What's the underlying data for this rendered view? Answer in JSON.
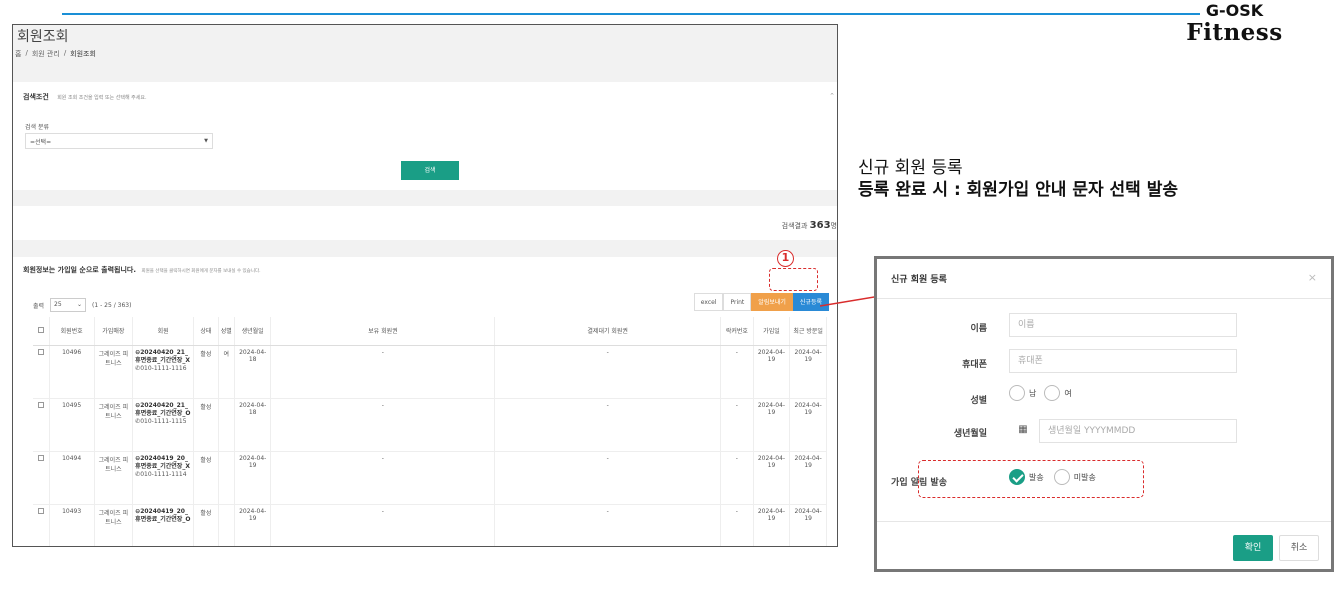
{
  "brand": {
    "line1": "G-OSK",
    "line2": "Fitness"
  },
  "app": {
    "title": "회원조회",
    "breadcrumb": [
      "홈",
      "/",
      "회원 관리",
      "/",
      "회원조회"
    ],
    "search": {
      "header": "검색조건",
      "hint": "회원 조회 조건을 입력 또는 선택해 주세요.",
      "category_label": "검색 분류",
      "category_value": "=선택=",
      "button": "검색"
    },
    "result": {
      "prefix": "검색결과",
      "count": "363",
      "suffix": "명"
    },
    "list": {
      "notice": "회원정보는 가입일 순으로 출력됩니다.",
      "notice_sub": "회원을 선택을 클릭하시면 회원에게 문자를 보내실 수 있습니다.",
      "per_page_label": "출력",
      "per_page_value": "25",
      "range": "(1 - 25 / 363)",
      "buttons": {
        "excel": "excel",
        "print": "Print",
        "sms": "알림보내기",
        "new": "신규등록"
      },
      "columns": [
        "회원번호",
        "가입매장",
        "회원",
        "상태",
        "성별",
        "생년월일",
        "보유 회원권",
        "결제대기 회원권",
        "락커번호",
        "가입일",
        "최근 방문일"
      ],
      "rows": [
        {
          "no": "10496",
          "store": "그레이즈 피트니스",
          "name": "20240420_21_휴면종료_기간연장_X",
          "phone": "010-1111-1116",
          "status": "활성",
          "gender": "여",
          "birth": "2024-04-18",
          "owned": "-",
          "pending": "-",
          "locker": "-",
          "joined": "2024-04-19",
          "visit": "2024-04-19"
        },
        {
          "no": "10495",
          "store": "그레이즈 피트니스",
          "name": "20240420_21_휴면종료_기간연장_O",
          "phone": "010-1111-1115",
          "status": "활성",
          "gender": "",
          "birth": "2024-04-18",
          "owned": "-",
          "pending": "-",
          "locker": "-",
          "joined": "2024-04-19",
          "visit": "2024-04-19"
        },
        {
          "no": "10494",
          "store": "그레이즈 피트니스",
          "name": "20240419_20_휴면종료_기간연장_X",
          "phone": "010-1111-1114",
          "status": "활성",
          "gender": "",
          "birth": "2024-04-19",
          "owned": "-",
          "pending": "-",
          "locker": "-",
          "joined": "2024-04-19",
          "visit": "2024-04-19"
        },
        {
          "no": "10493",
          "store": "그레이즈 피트니스",
          "name": "20240419_20_휴면종료_기간연장_O",
          "phone": "",
          "status": "활성",
          "gender": "",
          "birth": "2024-04-19",
          "owned": "-",
          "pending": "-",
          "locker": "-",
          "joined": "2024-04-19",
          "visit": "2024-04-19"
        }
      ]
    }
  },
  "annotation": {
    "marker": "1",
    "line1": "신규 회원 등록",
    "line2": "등록 완료 시 : 회원가입 안내 문자 선택 발송"
  },
  "modal": {
    "title": "신규 회원 등록",
    "close": "×",
    "name_label": "이름",
    "name_placeholder": "이름",
    "phone_label": "휴대폰",
    "phone_placeholder": "휴대폰",
    "gender_label": "성별",
    "gender_male": "남",
    "gender_female": "여",
    "birth_label": "생년월일",
    "birth_placeholder": "생년월일 YYYYMMDD",
    "notify_label": "가입 알림 발송",
    "notify_send": "발송",
    "notify_nosend": "미발송",
    "ok": "확인",
    "cancel": "취소"
  },
  "colors": {
    "accent_teal": "#1a9e86",
    "new_button": "#2a8ad6",
    "sms_button": "#f0a04a",
    "annotation_red": "#d92c2c",
    "header_line": "#1a8fd6"
  }
}
